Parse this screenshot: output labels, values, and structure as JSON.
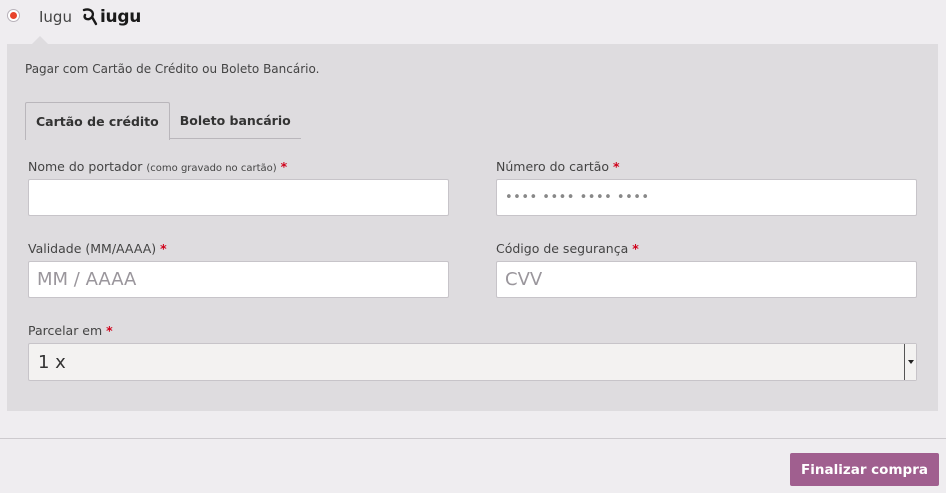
{
  "header": {
    "provider_name": "Iugu",
    "logo_text": "iugu",
    "radio_selected": true
  },
  "panel": {
    "instruction": "Pagar com Cartão de Crédito ou Boleto Bancário.",
    "tabs": [
      {
        "label": "Cartão de crédito",
        "active": true
      },
      {
        "label": "Boleto bancário",
        "active": false
      }
    ]
  },
  "form": {
    "holder_name": {
      "label": "Nome do portador",
      "hint": "(como gravado no cartão)",
      "required": "*",
      "value": "",
      "placeholder": ""
    },
    "card_number": {
      "label": "Número do cartão",
      "required": "*",
      "value": "",
      "placeholder": "•••• •••• •••• ••••"
    },
    "expiry": {
      "label": "Validade (MM/AAAA)",
      "required": "*",
      "value": "",
      "placeholder": "MM / AAAA"
    },
    "cvv": {
      "label": "Código de segurança",
      "required": "*",
      "value": "",
      "placeholder": "CVV"
    },
    "installments": {
      "label": "Parcelar em",
      "required": "*",
      "selected": "1 x"
    }
  },
  "footer": {
    "submit_label": "Finalizar compra"
  },
  "colors": {
    "accent": "#a05f8f",
    "required": "#d0021b",
    "panel_bg": "#dedcdf",
    "page_bg": "#efedf0"
  }
}
